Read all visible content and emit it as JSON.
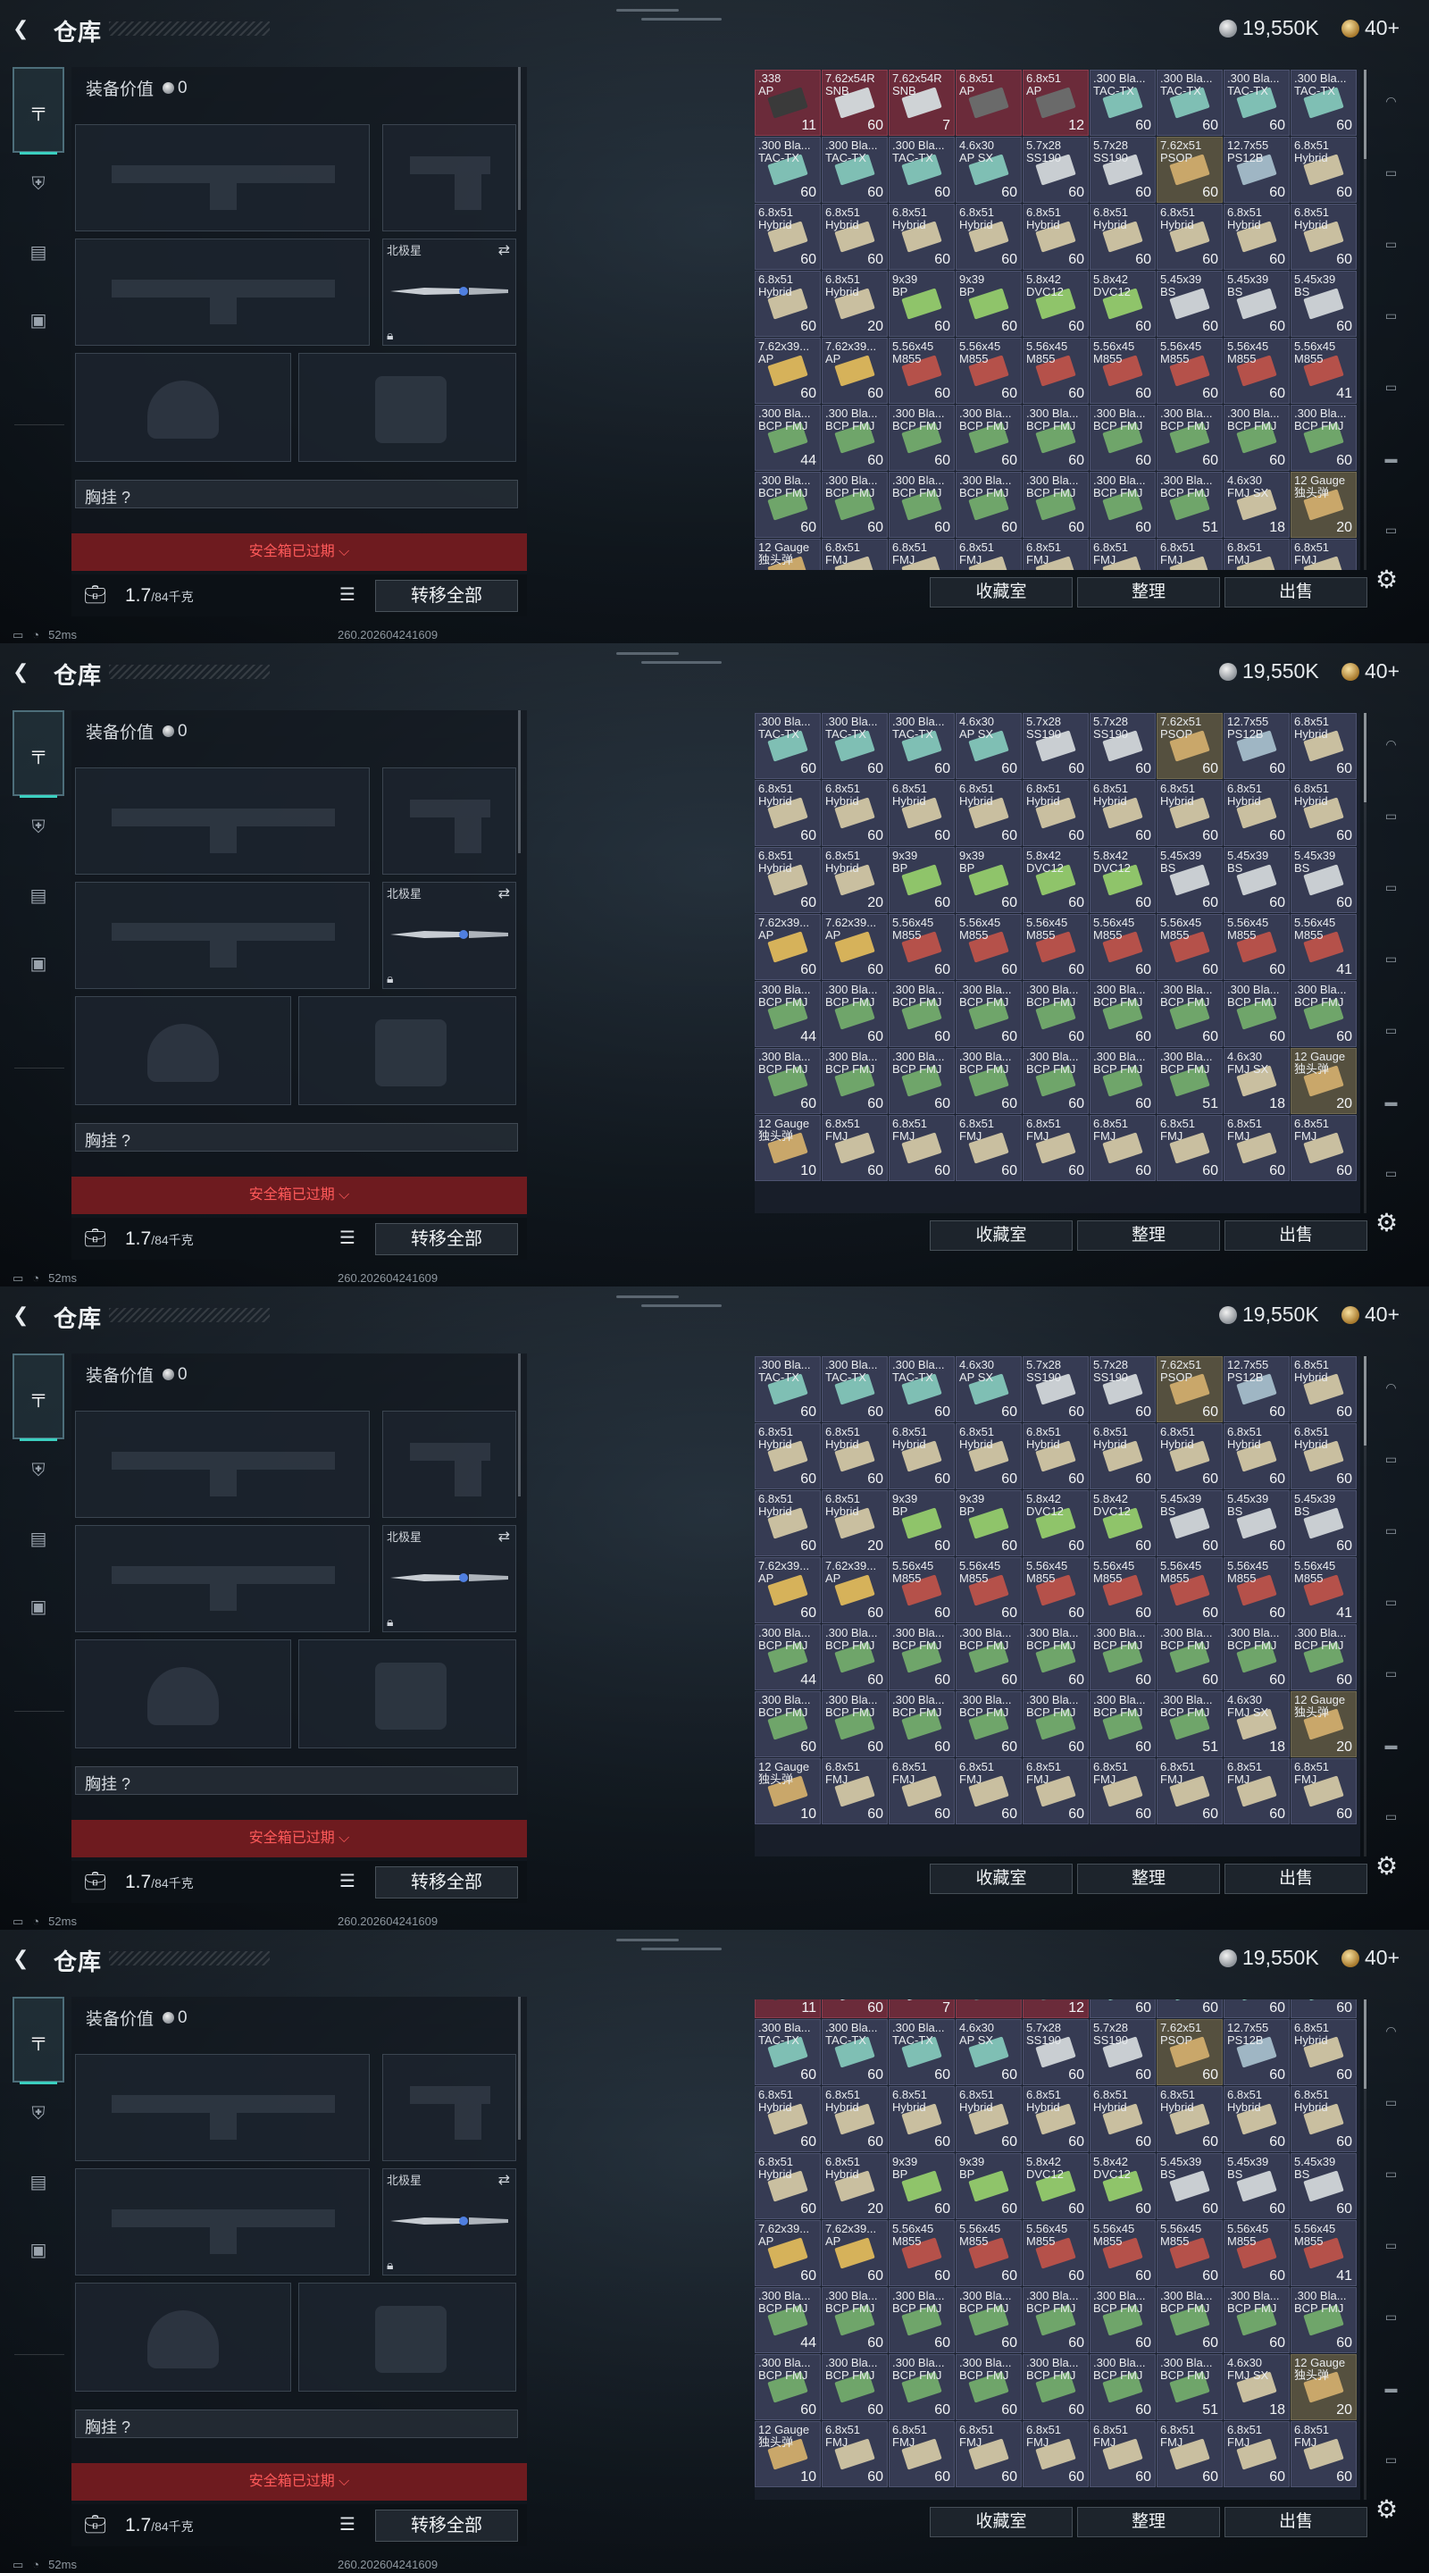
{
  "frames": [
    {
      "id": "frame-1",
      "scroll_rows": 0
    },
    {
      "id": "frame-2",
      "scroll_rows": 1
    },
    {
      "id": "frame-3",
      "scroll_rows": 1
    },
    {
      "id": "frame-4",
      "scroll_rows": 0.7
    }
  ],
  "topbar": {
    "title": "仓库",
    "silver": "19,550K",
    "gold": "40+"
  },
  "gear": {
    "equip_value_label": "装备价值",
    "equip_value": "0",
    "melee_label": "北极星",
    "chest_rig_label": "胸挂 ?",
    "safebox_label": "安全箱已过期 ⌵",
    "weight_value": "1.7",
    "weight_unit": "/84千克",
    "transfer_all": "转移全部"
  },
  "status": {
    "ping": "52ms",
    "build": "260.202604241609"
  },
  "actions": {
    "collection": "收藏室",
    "sort": "整理",
    "sell": "出售"
  },
  "colors": {
    "accent_teal": "#3bd0c0",
    "safebox_red": "#6e1b1f",
    "safebox_text": "#ff5a5a",
    "cell_blue": "#363b53",
    "cell_red": "#6b2b3a"
  },
  "storage_rows": [
    [
      {
        "name": ".338\nAP",
        "qty": "11",
        "bg": "red",
        "art": "#3a3a3a"
      },
      {
        "name": "7.62x54R\nSNB",
        "qty": "60",
        "bg": "red",
        "art": "#cfd3d6"
      },
      {
        "name": "7.62x54R\nSNB",
        "qty": "7",
        "bg": "red",
        "art": "#cfd3d6"
      },
      {
        "name": "6.8x51\nAP",
        "qty": "",
        "bg": "red",
        "art": "#6a6a6a"
      },
      {
        "name": "6.8x51\nAP",
        "qty": "12",
        "bg": "red",
        "art": "#6a6a6a"
      },
      {
        "name": ".300 Bla...\nTAC-TX",
        "qty": "60",
        "bg": "blue",
        "art": "#7fbfb4"
      },
      {
        "name": ".300 Bla...\nTAC-TX",
        "qty": "60",
        "bg": "blue",
        "art": "#7fbfb4"
      },
      {
        "name": ".300 Bla...\nTAC-TX",
        "qty": "60",
        "bg": "blue",
        "art": "#7fbfb4"
      },
      {
        "name": ".300 Bla...\nTAC-TX",
        "qty": "60",
        "bg": "blue",
        "art": "#7fbfb4"
      }
    ],
    [
      {
        "name": ".300 Bla...\nTAC-TX",
        "qty": "60",
        "bg": "blue",
        "art": "#7fbfb4"
      },
      {
        "name": ".300 Bla...\nTAC-TX",
        "qty": "60",
        "bg": "blue",
        "art": "#7fbfb4"
      },
      {
        "name": ".300 Bla...\nTAC-TX",
        "qty": "60",
        "bg": "blue",
        "art": "#7fbfb4"
      },
      {
        "name": "4.6x30\nAP SX",
        "qty": "60",
        "bg": "blue",
        "art": "#7fbfb4"
      },
      {
        "name": "5.7x28\nSS190",
        "qty": "60",
        "bg": "blue",
        "art": "#c9ced2"
      },
      {
        "name": "5.7x28\nSS190",
        "qty": "60",
        "bg": "blue",
        "art": "#c9ced2"
      },
      {
        "name": "7.62x51\nPSOP",
        "qty": "60",
        "bg": "tan",
        "art": "#c9a76a"
      },
      {
        "name": "12.7x55\nPS12B",
        "qty": "60",
        "bg": "blue",
        "art": "#9fb6c4"
      },
      {
        "name": "6.8x51\nHybrid",
        "qty": "60",
        "bg": "blue",
        "art": "#c9bfa0"
      }
    ],
    [
      {
        "name": "6.8x51\nHybrid",
        "qty": "60",
        "bg": "blue",
        "art": "#c9bfa0"
      },
      {
        "name": "6.8x51\nHybrid",
        "qty": "60",
        "bg": "blue",
        "art": "#c9bfa0"
      },
      {
        "name": "6.8x51\nHybrid",
        "qty": "60",
        "bg": "blue",
        "art": "#c9bfa0"
      },
      {
        "name": "6.8x51\nHybrid",
        "qty": "60",
        "bg": "blue",
        "art": "#c9bfa0"
      },
      {
        "name": "6.8x51\nHybrid",
        "qty": "60",
        "bg": "blue",
        "art": "#c9bfa0"
      },
      {
        "name": "6.8x51\nHybrid",
        "qty": "60",
        "bg": "blue",
        "art": "#c9bfa0"
      },
      {
        "name": "6.8x51\nHybrid",
        "qty": "60",
        "bg": "blue",
        "art": "#c9bfa0"
      },
      {
        "name": "6.8x51\nHybrid",
        "qty": "60",
        "bg": "blue",
        "art": "#c9bfa0"
      },
      {
        "name": "6.8x51\nHybrid",
        "qty": "60",
        "bg": "blue",
        "art": "#c9bfa0"
      }
    ],
    [
      {
        "name": "6.8x51\nHybrid",
        "qty": "60",
        "bg": "blue",
        "art": "#c9bfa0"
      },
      {
        "name": "6.8x51\nHybrid",
        "qty": "20",
        "bg": "blue",
        "art": "#c9bfa0"
      },
      {
        "name": "9x39\nBP",
        "qty": "60",
        "bg": "blue",
        "art": "#8fc46a"
      },
      {
        "name": "9x39\nBP",
        "qty": "60",
        "bg": "blue",
        "art": "#8fc46a"
      },
      {
        "name": "5.8x42\nDVC12",
        "qty": "60",
        "bg": "blue",
        "art": "#8fc46a"
      },
      {
        "name": "5.8x42\nDVC12",
        "qty": "60",
        "bg": "blue",
        "art": "#8fc46a"
      },
      {
        "name": "5.45x39\nBS",
        "qty": "60",
        "bg": "blue",
        "art": "#c9ced2"
      },
      {
        "name": "5.45x39\nBS",
        "qty": "60",
        "bg": "blue",
        "art": "#c9ced2"
      },
      {
        "name": "5.45x39\nBS",
        "qty": "60",
        "bg": "blue",
        "art": "#c9ced2"
      }
    ],
    [
      {
        "name": "7.62x39...\nAP",
        "qty": "60",
        "bg": "blue",
        "art": "#d6b25a"
      },
      {
        "name": "7.62x39...\nAP",
        "qty": "60",
        "bg": "blue",
        "art": "#d6b25a"
      },
      {
        "name": "5.56x45\nM855",
        "qty": "60",
        "bg": "blue",
        "art": "#b5514a"
      },
      {
        "name": "5.56x45\nM855",
        "qty": "60",
        "bg": "blue",
        "art": "#b5514a"
      },
      {
        "name": "5.56x45\nM855",
        "qty": "60",
        "bg": "blue",
        "art": "#b5514a"
      },
      {
        "name": "5.56x45\nM855",
        "qty": "60",
        "bg": "blue",
        "art": "#b5514a"
      },
      {
        "name": "5.56x45\nM855",
        "qty": "60",
        "bg": "blue",
        "art": "#b5514a"
      },
      {
        "name": "5.56x45\nM855",
        "qty": "60",
        "bg": "blue",
        "art": "#b5514a"
      },
      {
        "name": "5.56x45\nM855",
        "qty": "41",
        "bg": "blue",
        "art": "#b5514a"
      }
    ],
    [
      {
        "name": ".300 Bla...\nBCP FMJ",
        "qty": "44",
        "bg": "blue",
        "art": "#6fa56a"
      },
      {
        "name": ".300 Bla...\nBCP FMJ",
        "qty": "60",
        "bg": "blue",
        "art": "#6fa56a"
      },
      {
        "name": ".300 Bla...\nBCP FMJ",
        "qty": "60",
        "bg": "blue",
        "art": "#6fa56a"
      },
      {
        "name": ".300 Bla...\nBCP FMJ",
        "qty": "60",
        "bg": "blue",
        "art": "#6fa56a"
      },
      {
        "name": ".300 Bla...\nBCP FMJ",
        "qty": "60",
        "bg": "blue",
        "art": "#6fa56a"
      },
      {
        "name": ".300 Bla...\nBCP FMJ",
        "qty": "60",
        "bg": "blue",
        "art": "#6fa56a"
      },
      {
        "name": ".300 Bla...\nBCP FMJ",
        "qty": "60",
        "bg": "blue",
        "art": "#6fa56a"
      },
      {
        "name": ".300 Bla...\nBCP FMJ",
        "qty": "60",
        "bg": "blue",
        "art": "#6fa56a"
      },
      {
        "name": ".300 Bla...\nBCP FMJ",
        "qty": "60",
        "bg": "blue",
        "art": "#6fa56a"
      }
    ],
    [
      {
        "name": ".300 Bla...\nBCP FMJ",
        "qty": "60",
        "bg": "blue",
        "art": "#6fa56a"
      },
      {
        "name": ".300 Bla...\nBCP FMJ",
        "qty": "60",
        "bg": "blue",
        "art": "#6fa56a"
      },
      {
        "name": ".300 Bla...\nBCP FMJ",
        "qty": "60",
        "bg": "blue",
        "art": "#6fa56a"
      },
      {
        "name": ".300 Bla...\nBCP FMJ",
        "qty": "60",
        "bg": "blue",
        "art": "#6fa56a"
      },
      {
        "name": ".300 Bla...\nBCP FMJ",
        "qty": "60",
        "bg": "blue",
        "art": "#6fa56a"
      },
      {
        "name": ".300 Bla...\nBCP FMJ",
        "qty": "60",
        "bg": "blue",
        "art": "#6fa56a"
      },
      {
        "name": ".300 Bla...\nBCP FMJ",
        "qty": "51",
        "bg": "blue",
        "art": "#6fa56a"
      },
      {
        "name": "4.6x30\nFMJ SX",
        "qty": "18",
        "bg": "blue",
        "art": "#c9bfa0"
      },
      {
        "name": "12 Gauge\n独头弹",
        "qty": "20",
        "bg": "tan",
        "art": "#c9a76a"
      }
    ],
    [
      {
        "name": "12 Gauge\n独头弹",
        "qty": "10",
        "bg": "blue",
        "art": "#c9a76a"
      },
      {
        "name": "6.8x51\nFMJ",
        "qty": "60",
        "bg": "blue",
        "art": "#c9bfa0"
      },
      {
        "name": "6.8x51\nFMJ",
        "qty": "60",
        "bg": "blue",
        "art": "#c9bfa0"
      },
      {
        "name": "6.8x51\nFMJ",
        "qty": "60",
        "bg": "blue",
        "art": "#c9bfa0"
      },
      {
        "name": "6.8x51\nFMJ",
        "qty": "60",
        "bg": "blue",
        "art": "#c9bfa0"
      },
      {
        "name": "6.8x51\nFMJ",
        "qty": "60",
        "bg": "blue",
        "art": "#c9bfa0"
      },
      {
        "name": "6.8x51\nFMJ",
        "qty": "60",
        "bg": "blue",
        "art": "#c9bfa0"
      },
      {
        "name": "6.8x51\nFMJ",
        "qty": "60",
        "bg": "blue",
        "art": "#c9bfa0"
      },
      {
        "name": "6.8x51\nFMJ",
        "qty": "60",
        "bg": "blue",
        "art": "#c9bfa0"
      }
    ]
  ],
  "side_tabs": [
    {
      "name": "weapons-tab",
      "icon": "gun-icon",
      "glyph": "╤"
    },
    {
      "name": "armor-tab",
      "icon": "vest-icon",
      "glyph": "⛨"
    },
    {
      "name": "rig-tab",
      "icon": "clipboard-icon",
      "glyph": "▤"
    },
    {
      "name": "backpack-tab",
      "icon": "briefcase-icon",
      "glyph": "▣"
    }
  ],
  "rail_icons": [
    {
      "name": "helmet-icon",
      "glyph": "◠"
    },
    {
      "name": "gunsight-icon",
      "glyph": "▭"
    },
    {
      "name": "card-icon-v",
      "glyph": "▭"
    },
    {
      "name": "card-icon-iv",
      "glyph": "▭"
    },
    {
      "name": "card-icon-iii",
      "glyph": "▭"
    },
    {
      "name": "folder-icon",
      "glyph": "▬"
    },
    {
      "name": "card-icon-iv-b",
      "glyph": "▭"
    }
  ]
}
